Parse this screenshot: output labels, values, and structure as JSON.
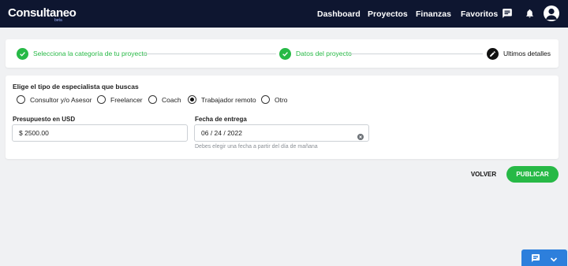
{
  "header": {
    "logo": "Consultaneo",
    "logo_badge": "beta",
    "nav": [
      "Dashboard",
      "Proyectos",
      "Finanzas",
      "Favoritos"
    ],
    "icons": [
      "chat-icon",
      "bell-icon",
      "user-avatar-icon"
    ]
  },
  "stepper": {
    "steps": [
      {
        "label": "Selecciona la categoría de tu proyecto",
        "state": "done"
      },
      {
        "label": "Datos del proyecto",
        "state": "done"
      },
      {
        "label": "Ultimos detalles",
        "state": "current"
      }
    ]
  },
  "form": {
    "specialist_title": "Elige el tipo de especialista que buscas",
    "options": [
      "Consultor y/o Asesor",
      "Freelancer",
      "Coach",
      "Trabajador remoto",
      "Otro"
    ],
    "selected_option": "Trabajador remoto",
    "budget_label": "Presupuesto en USD",
    "budget_value": "$ 2500.00",
    "date_label": "Fecha de entrega",
    "date_value": "06 / 24 / 2022",
    "date_hint": "Debes elegir una fecha a partir del día de mañana"
  },
  "actions": {
    "back": "VOLVER",
    "publish": "PUBLICAR"
  },
  "colors": {
    "header_bg": "#0e1630",
    "accent_green": "#27b946",
    "chat_blue": "#2d7fdc"
  }
}
